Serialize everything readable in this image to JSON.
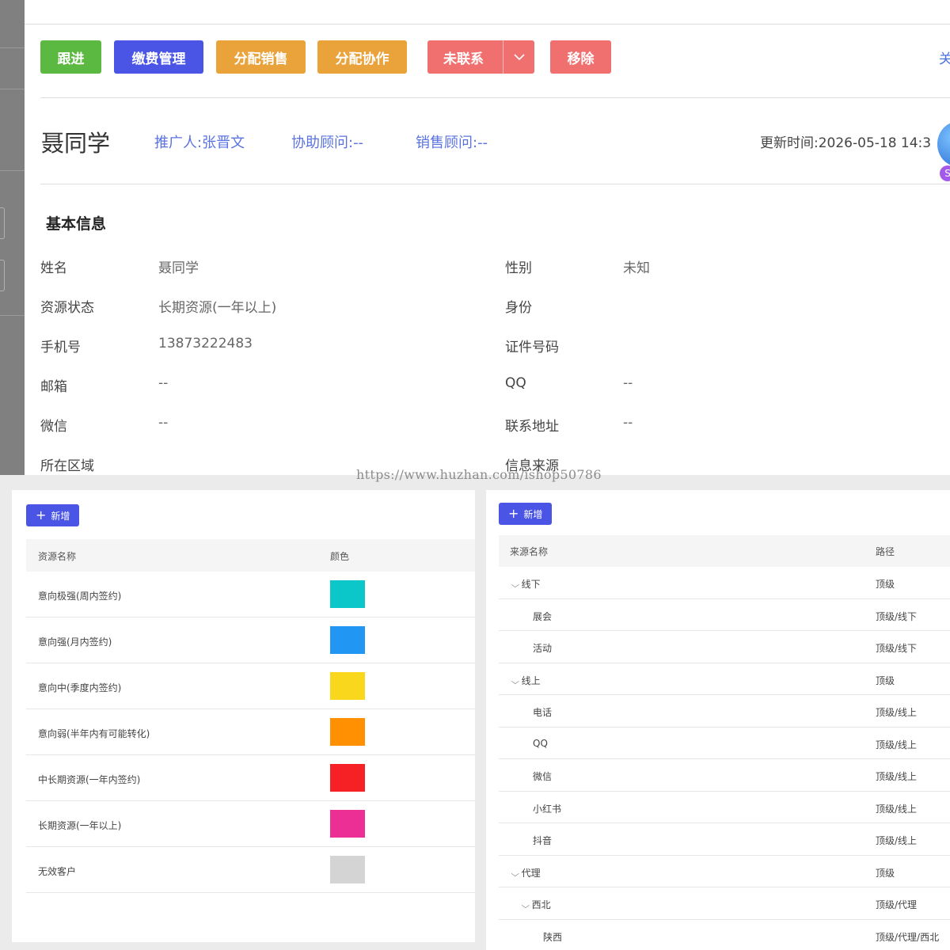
{
  "toolbar": {
    "follow": "跟进",
    "fee_manage": "缴费管理",
    "assign_sales": "分配销售",
    "assign_collab": "分配协作",
    "contact_status": "未联系",
    "remove": "移除",
    "close_partial": "关"
  },
  "header": {
    "name": "聂同学",
    "promoter": "推广人:张晋文",
    "assist_advisor": "协助顾问:--",
    "sales_advisor": "销售顾问:--",
    "update_time": "更新时间:2026-05-18 14:3",
    "badge": "S"
  },
  "basic_info": {
    "title": "基本信息",
    "fields": [
      {
        "label": "姓名",
        "value": "聂同学"
      },
      {
        "label": "性别",
        "value": "未知"
      },
      {
        "label": "资源状态",
        "value": "长期资源(一年以上)"
      },
      {
        "label": "身份",
        "value": ""
      },
      {
        "label": "手机号",
        "value": "13873222483"
      },
      {
        "label": "证件号码",
        "value": ""
      },
      {
        "label": "邮箱",
        "value": "--"
      },
      {
        "label": "QQ",
        "value": "--"
      },
      {
        "label": "微信",
        "value": "--"
      },
      {
        "label": "联系地址",
        "value": "--"
      },
      {
        "label": "所在区域",
        "value": ""
      },
      {
        "label": "信息来源",
        "value": ""
      }
    ]
  },
  "watermark": "https://www.huzhan.com/ishop50786",
  "resource_table": {
    "add_label": "新增",
    "columns": [
      "资源名称",
      "颜色"
    ],
    "rows": [
      {
        "name": "意向极强(周内签约)",
        "color": "#0cc7c9"
      },
      {
        "name": "意向强(月内签约)",
        "color": "#2196f3"
      },
      {
        "name": "意向中(季度内签约)",
        "color": "#f9d71c"
      },
      {
        "name": "意向弱(半年内有可能转化)",
        "color": "#ff9002"
      },
      {
        "name": "中长期资源(一年内签约)",
        "color": "#f52124"
      },
      {
        "name": "长期资源(一年以上)",
        "color": "#ec2f95"
      },
      {
        "name": "无效客户",
        "color": "#d4d4d4"
      }
    ]
  },
  "source_table": {
    "add_label": "新增",
    "columns": [
      "来源名称",
      "路径"
    ],
    "rows": [
      {
        "name": "线下",
        "path": "顶级",
        "expandable": true,
        "level": 0
      },
      {
        "name": "展会",
        "path": "顶级/线下",
        "expandable": false,
        "level": 1
      },
      {
        "name": "活动",
        "path": "顶级/线下",
        "expandable": false,
        "level": 1
      },
      {
        "name": "线上",
        "path": "顶级",
        "expandable": true,
        "level": 0
      },
      {
        "name": "电话",
        "path": "顶级/线上",
        "expandable": false,
        "level": 1
      },
      {
        "name": "QQ",
        "path": "顶级/线上",
        "expandable": false,
        "level": 1
      },
      {
        "name": "微信",
        "path": "顶级/线上",
        "expandable": false,
        "level": 1
      },
      {
        "name": "小红书",
        "path": "顶级/线上",
        "expandable": false,
        "level": 1
      },
      {
        "name": "抖音",
        "path": "顶级/线上",
        "expandable": false,
        "level": 1
      },
      {
        "name": "代理",
        "path": "顶级",
        "expandable": true,
        "level": 0
      },
      {
        "name": "西北",
        "path": "顶级/代理",
        "expandable": true,
        "level": 1
      },
      {
        "name": "陕西",
        "path": "顶级/代理/西北",
        "expandable": false,
        "level": 2
      }
    ]
  },
  "colors": {
    "primary": "#4a55e6",
    "success": "#5bb840",
    "warning": "#eaa23a",
    "danger": "#f07070",
    "link": "#5a73e0"
  }
}
